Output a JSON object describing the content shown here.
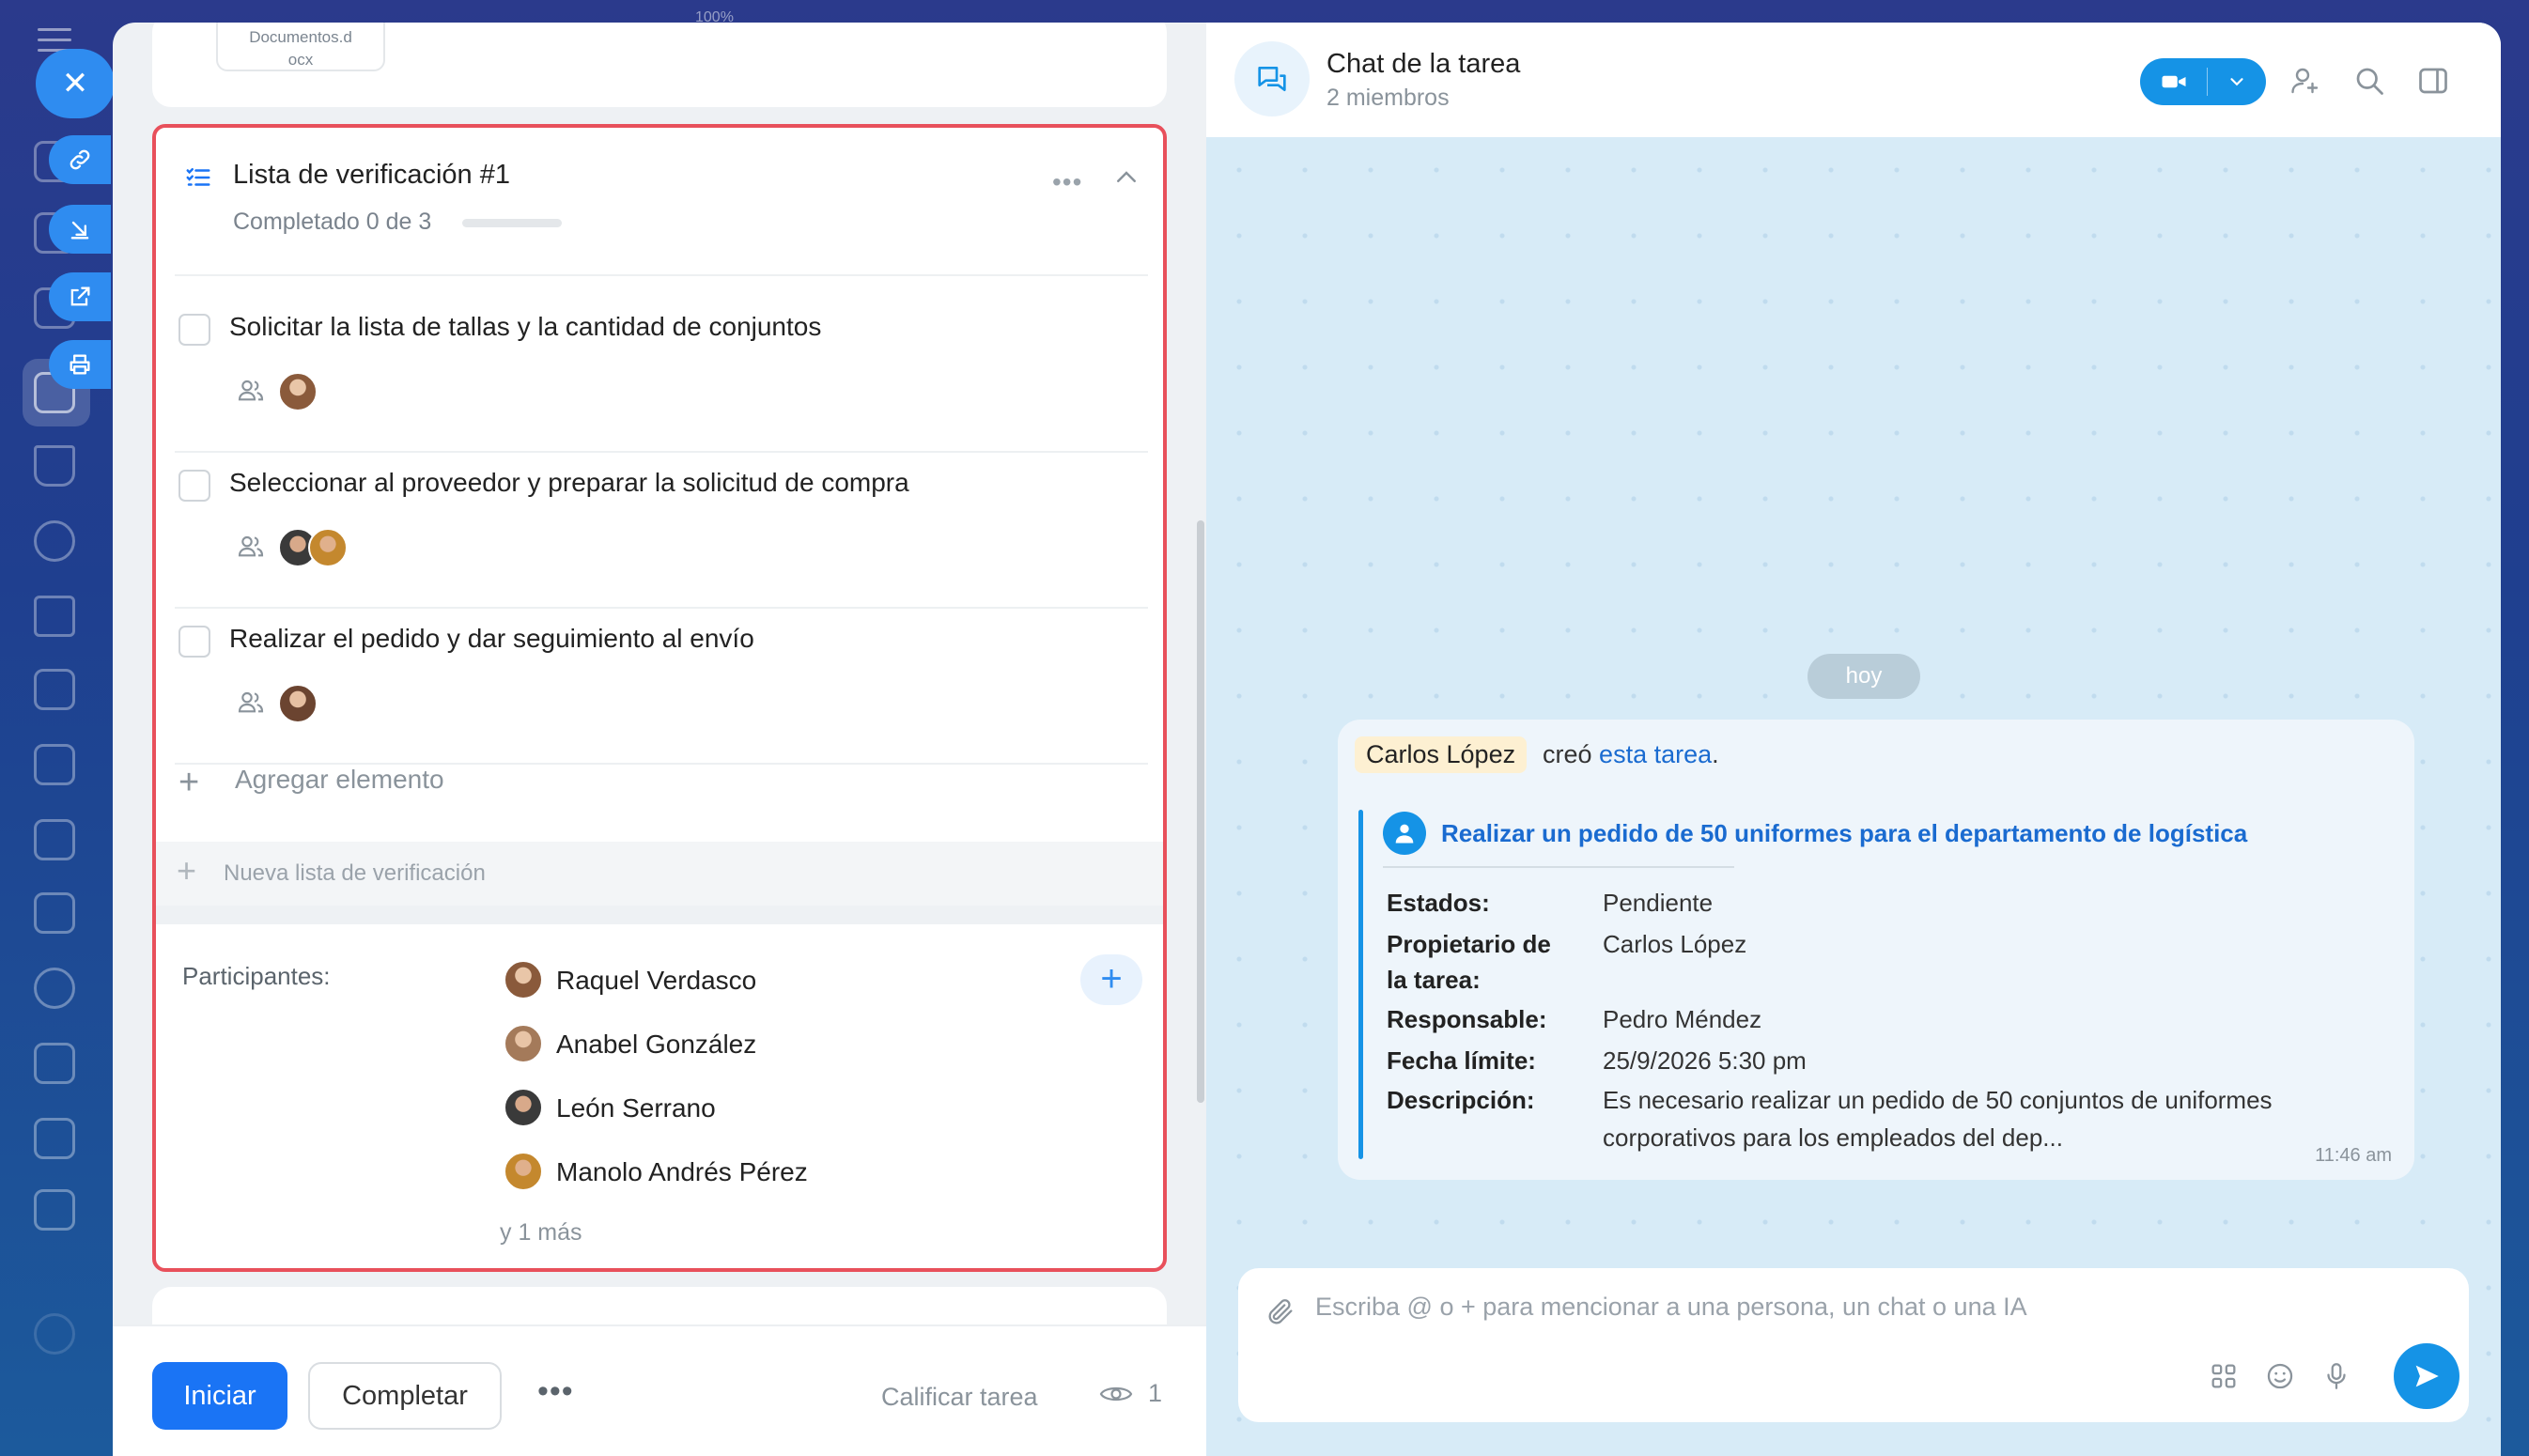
{
  "window": {
    "zoom": "100%"
  },
  "document_card": {
    "file_name": "Documentos.docx",
    "file_name_line1": "Documentos.d",
    "file_name_line2": "ocx"
  },
  "checklist": {
    "title": "Lista de verificación #1",
    "progress_text": "Completado 0 de 3",
    "progress": 0,
    "items": [
      {
        "text": "Solicitar la lista de tallas y la cantidad de conjuntos",
        "checked": false
      },
      {
        "text": "Seleccionar al proveedor y preparar la solicitud de compra",
        "checked": false
      },
      {
        "text": "Realizar el pedido y dar seguimiento al envío",
        "checked": false
      }
    ],
    "add_item_label": "Agregar elemento",
    "new_list_label": "Nueva lista de verificación"
  },
  "participants": {
    "label": "Participantes:",
    "people": [
      "Raquel Verdasco",
      "Anabel González",
      "León Serrano",
      "Manolo Andrés Pérez"
    ],
    "more": "y 1 más"
  },
  "footer": {
    "start_label": "Iniciar",
    "complete_label": "Completar",
    "more_label": "•••",
    "rate_label": "Calificar tarea",
    "views_count": "1"
  },
  "chat": {
    "title": "Chat de la tarea",
    "subtitle": "2 miembros",
    "date_divider": "hoy",
    "message": {
      "author": "Carlos López",
      "created_text": "creó",
      "task_link": "esta tarea",
      "period": ".",
      "task_title": "Realizar un pedido de 50 uniformes para el departamento de logística",
      "fields": [
        {
          "label": "Estados:",
          "value": "Pendiente"
        },
        {
          "label": "Propietario de",
          "label2": "la tarea:",
          "value": "Carlos López"
        },
        {
          "label": "Responsable:",
          "value": "Pedro Méndez"
        },
        {
          "label": "Fecha límite:",
          "value": "25/9/2026 5:30 pm"
        },
        {
          "label": "Descripción:",
          "value": "Es necesario realizar un pedido de 50 conjuntos de uniformes",
          "value2": "corporativos para los empleados del dep..."
        }
      ],
      "time": "11:46 am"
    },
    "composer_placeholder": "Escriba @ o + para mencionar a una persona, un chat o una IA"
  },
  "colors": {
    "accent": "#1a74f5",
    "chat_accent": "#1593e6",
    "highlight_border": "#e8505b"
  }
}
